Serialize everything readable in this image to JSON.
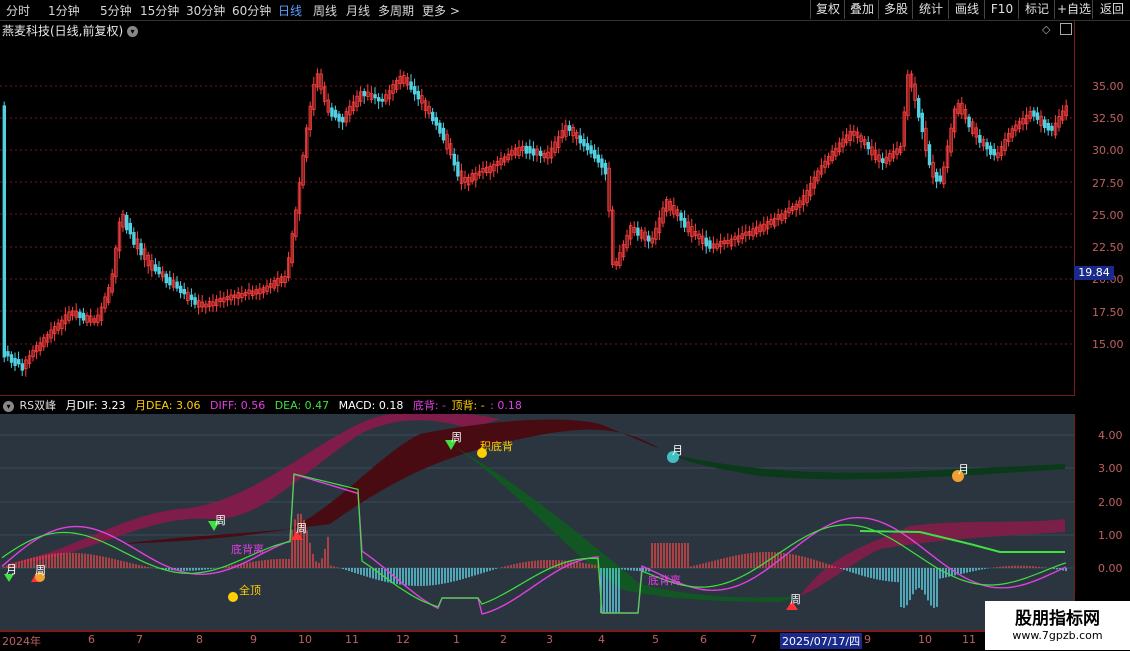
{
  "periods": [
    "分时",
    "1分钟",
    "5分钟",
    "15分钟",
    "30分钟",
    "60分钟",
    "日线",
    "周线",
    "月线",
    "多周期",
    "更多 >"
  ],
  "active_period": "日线",
  "toolbar": [
    "复权",
    "叠加",
    "多股",
    "统计",
    "画线",
    "F10",
    "标记",
    "+自选",
    "返回"
  ],
  "stock_title": "燕麦科技(日线,前复权)",
  "price_axis": [
    "35.00",
    "32.50",
    "30.00",
    "27.50",
    "25.00",
    "22.50",
    "20.00",
    "17.50",
    "15.00"
  ],
  "current_price": "19.84",
  "indicator": {
    "name": "RS双峰",
    "month_dif": "月DIF: 3.23",
    "month_dea": "月DEA: 3.06",
    "diff": "DIFF: 0.56",
    "dea": "DEA: 0.47",
    "macd": "MACD: 0.18",
    "bottom_div": "底背: -",
    "top_div": "顶背: -",
    "extra": ": 0.18"
  },
  "indicator_axis": [
    "4.00",
    "3.00",
    "2.00",
    "1.00",
    "0.00"
  ],
  "annotations": {
    "week1": "周",
    "week2": "周",
    "week3": "周",
    "week4": "周",
    "week5": "周",
    "month1": "月",
    "month2": "月",
    "month3": "月",
    "div1": "底背离",
    "div2": "底背离",
    "accum": "积底背",
    "full": "全顶"
  },
  "dates": [
    "2024年",
    "6",
    "7",
    "8",
    "9",
    "10",
    "11",
    "12",
    "1",
    "2",
    "3",
    "4",
    "5",
    "6",
    "7",
    "2025/07/17/四",
    "9",
    "10",
    "11"
  ],
  "watermark": {
    "line1": "股朋指标网",
    "line2": "www.7gpzb.com"
  },
  "colors": {
    "up": "#ff4040",
    "down": "#50d0e0",
    "grid": "#7a1a1a"
  }
}
